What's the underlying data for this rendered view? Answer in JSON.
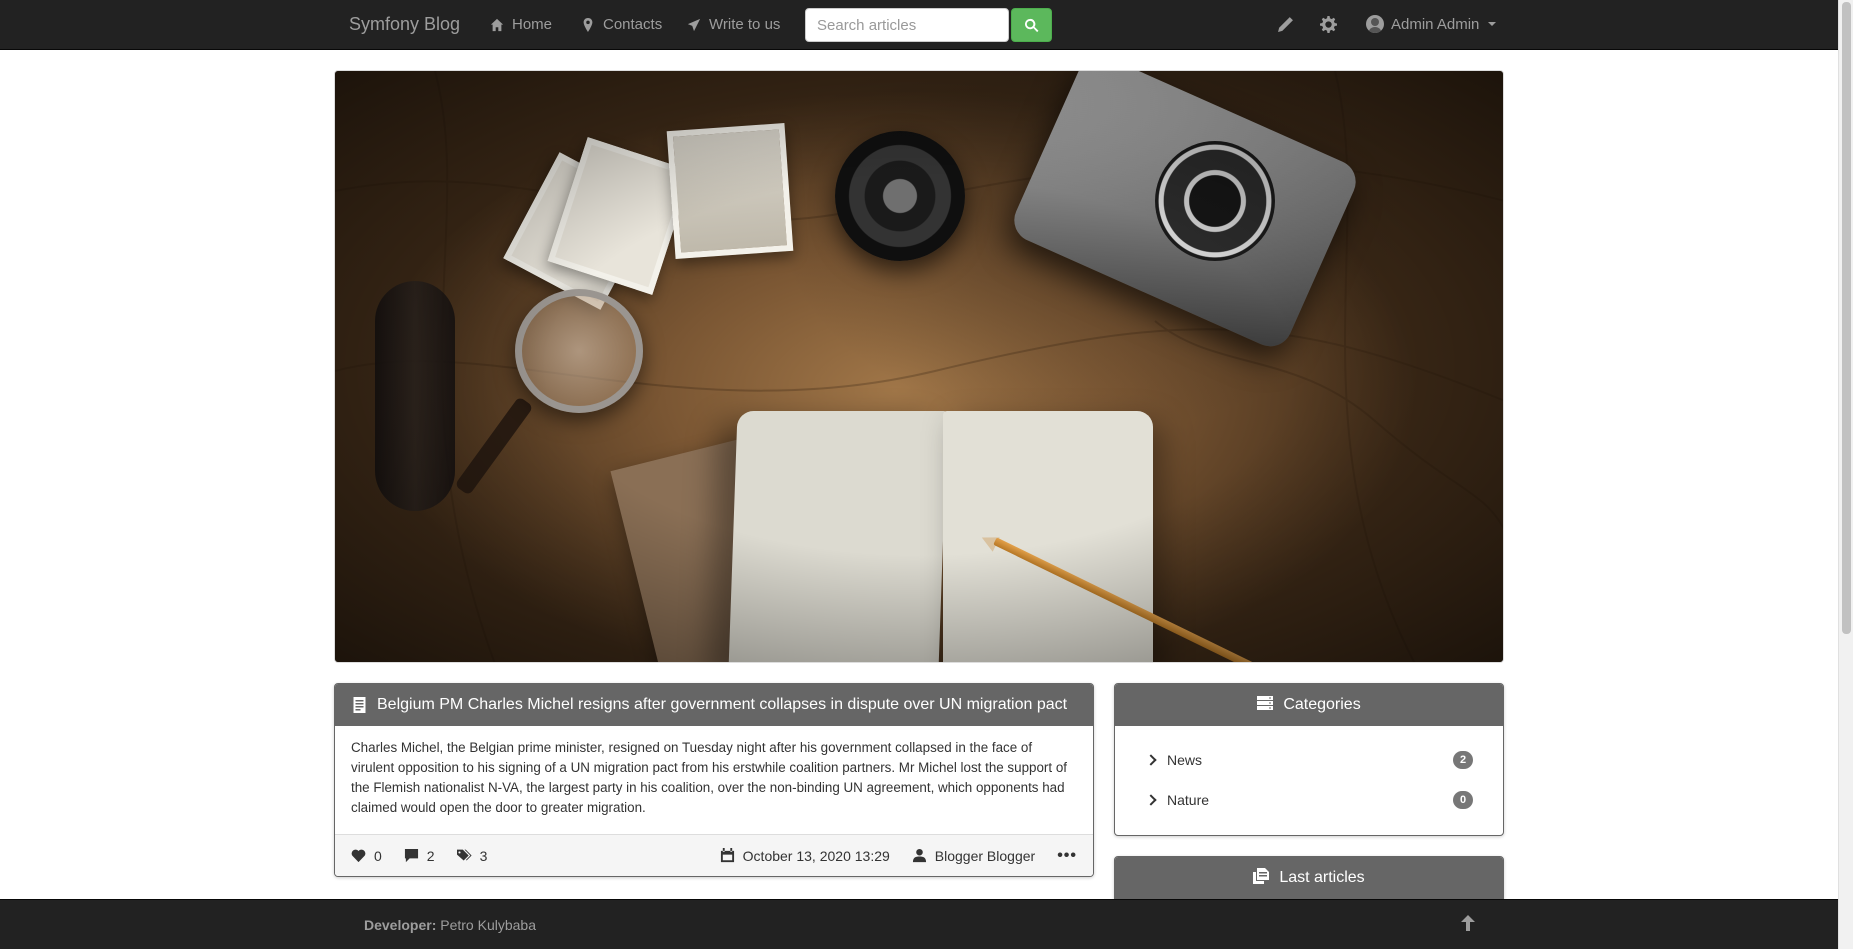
{
  "navbar": {
    "brand": "Symfony Blog",
    "links": [
      {
        "label": "Home",
        "icon": "home-icon"
      },
      {
        "label": "Contacts",
        "icon": "map-marker-icon"
      },
      {
        "label": "Write to us",
        "icon": "send-icon"
      }
    ],
    "search_placeholder": "Search articles",
    "icons": [
      "pencil-icon",
      "gear-icon"
    ],
    "user_name": "Admin Admin"
  },
  "article": {
    "title": "Belgium PM Charles Michel resigns after government collapses in dispute over UN migration pact",
    "body": "Charles Michel, the Belgian prime minister, resigned on Tuesday night after his government collapsed in the face of virulent opposition to his signing of a UN migration pact from his erstwhile coalition partners. Mr Michel lost the support of the Flemish nationalist N-VA, the largest party in his coalition, over the non-binding UN agreement, which opponents had claimed would open the door to greater migration.",
    "likes": "0",
    "comments": "2",
    "tags": "3",
    "date": "October 13, 2020 13:29",
    "author": "Blogger Blogger",
    "more": "•••"
  },
  "sidebar": {
    "categories_title": "Categories",
    "categories": [
      {
        "name": "News",
        "count": "2"
      },
      {
        "name": "Nature",
        "count": "0"
      }
    ],
    "last_articles_title": "Last articles"
  },
  "footer": {
    "developer_label": "Developer:",
    "developer_name": "Petro Kulybaba"
  },
  "colors": {
    "navbar_bg": "#222222",
    "panel_heading": "#666666",
    "search_button": "#5cb85c"
  }
}
